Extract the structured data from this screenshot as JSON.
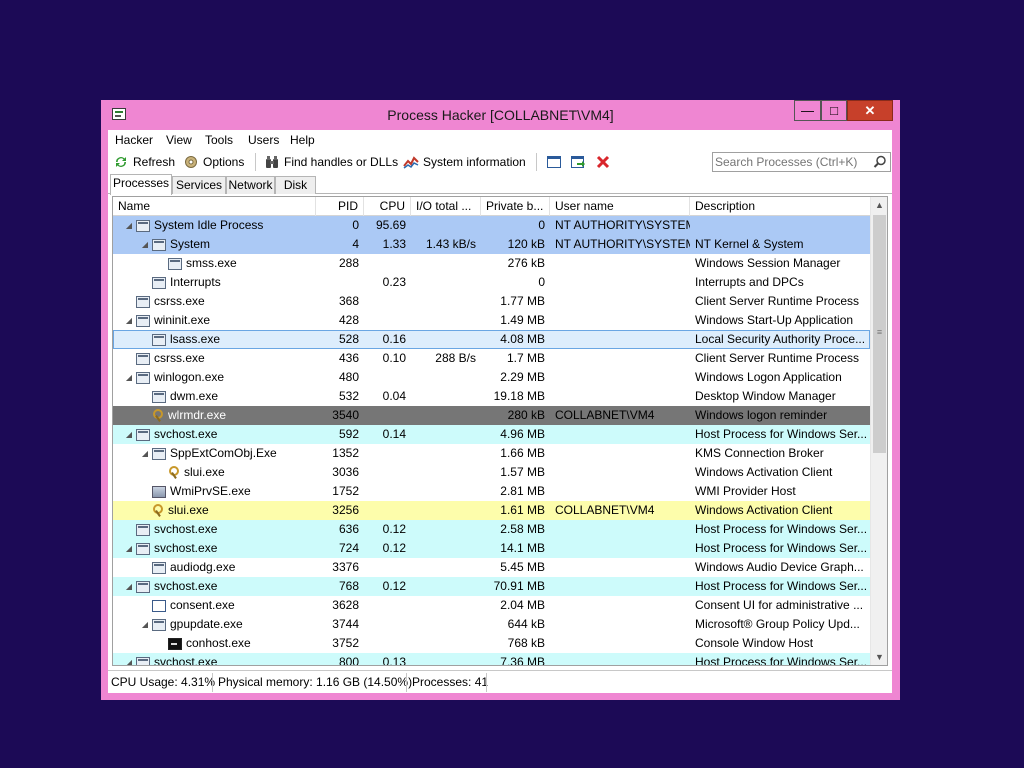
{
  "window": {
    "title": "Process Hacker [COLLABNET\\VM4]",
    "min_label": "—",
    "max_label": "□",
    "close_label": "✕"
  },
  "menu": [
    "Hacker",
    "View",
    "Tools",
    "Users",
    "Help"
  ],
  "toolbar": {
    "refresh": "Refresh",
    "options": "Options",
    "find_handles": "Find handles or DLLs",
    "system_info": "System information",
    "search_placeholder": "Search Processes (Ctrl+K)"
  },
  "tabs": [
    "Processes",
    "Services",
    "Network",
    "Disk"
  ],
  "columns": [
    "Name",
    "PID",
    "CPU",
    "I/O total ...",
    "Private b...",
    "User name",
    "Description"
  ],
  "processes": [
    {
      "name": "System Idle Process",
      "pid": "0",
      "cpu": "95.69",
      "io": "",
      "private": "0",
      "user": "NT AUTHORITY\\SYSTEM",
      "desc": "",
      "icon": "window-icon",
      "expander": "collapse-arrow",
      "style": "system"
    },
    {
      "name": "System",
      "pid": "4",
      "cpu": "1.33",
      "io": "1.43 kB/s",
      "private": "120 kB",
      "user": "NT AUTHORITY\\SYSTEM",
      "desc": "NT Kernel & System",
      "icon": "window-icon",
      "expander": "collapse-arrow",
      "style": "system"
    },
    {
      "name": "smss.exe",
      "pid": "288",
      "cpu": "",
      "io": "",
      "private": "276 kB",
      "user": "",
      "desc": "Windows Session Manager",
      "icon": "window-icon",
      "expander": "",
      "style": ""
    },
    {
      "name": "Interrupts",
      "pid": "",
      "cpu": "0.23",
      "io": "",
      "private": "0",
      "user": "",
      "desc": "Interrupts and DPCs",
      "icon": "window-icon",
      "expander": "",
      "style": ""
    },
    {
      "name": "csrss.exe",
      "pid": "368",
      "cpu": "",
      "io": "",
      "private": "1.77 MB",
      "user": "",
      "desc": "Client Server Runtime Process",
      "icon": "window-icon",
      "expander": "",
      "style": ""
    },
    {
      "name": "wininit.exe",
      "pid": "428",
      "cpu": "",
      "io": "",
      "private": "1.49 MB",
      "user": "",
      "desc": "Windows Start-Up Application",
      "icon": "window-icon",
      "expander": "collapse-arrow",
      "style": ""
    },
    {
      "name": "lsass.exe",
      "pid": "528",
      "cpu": "0.16",
      "io": "",
      "private": "4.08 MB",
      "user": "",
      "desc": "Local Security Authority Proce...",
      "icon": "window-icon",
      "expander": "",
      "style": "selected"
    },
    {
      "name": "csrss.exe",
      "pid": "436",
      "cpu": "0.10",
      "io": "288 B/s",
      "private": "1.7 MB",
      "user": "",
      "desc": "Client Server Runtime Process",
      "icon": "window-icon",
      "expander": "",
      "style": ""
    },
    {
      "name": "winlogon.exe",
      "pid": "480",
      "cpu": "",
      "io": "",
      "private": "2.29 MB",
      "user": "",
      "desc": "Windows Logon Application",
      "icon": "window-icon",
      "expander": "collapse-arrow",
      "style": ""
    },
    {
      "name": "dwm.exe",
      "pid": "532",
      "cpu": "0.04",
      "io": "",
      "private": "19.18 MB",
      "user": "",
      "desc": "Desktop Window Manager",
      "icon": "window-icon",
      "expander": "",
      "style": ""
    },
    {
      "name": "wlrmdr.exe",
      "pid": "3540",
      "cpu": "",
      "io": "",
      "private": "280 kB",
      "user": "COLLABNET\\VM4",
      "desc": "Windows logon reminder",
      "icon": "key-icon",
      "expander": "",
      "style": "dark"
    },
    {
      "name": "svchost.exe",
      "pid": "592",
      "cpu": "0.14",
      "io": "",
      "private": "4.96 MB",
      "user": "",
      "desc": "Host Process for Windows Ser...",
      "icon": "window-icon",
      "expander": "collapse-arrow",
      "style": "service"
    },
    {
      "name": "SppExtComObj.Exe",
      "pid": "1352",
      "cpu": "",
      "io": "",
      "private": "1.66 MB",
      "user": "",
      "desc": "KMS Connection Broker",
      "icon": "window-icon",
      "expander": "collapse-arrow",
      "style": ""
    },
    {
      "name": "slui.exe",
      "pid": "3036",
      "cpu": "",
      "io": "",
      "private": "1.57 MB",
      "user": "",
      "desc": "Windows Activation Client",
      "icon": "key-icon",
      "expander": "",
      "style": ""
    },
    {
      "name": "WmiPrvSE.exe",
      "pid": "1752",
      "cpu": "",
      "io": "",
      "private": "2.81 MB",
      "user": "",
      "desc": "WMI Provider Host",
      "icon": "wmi-icon",
      "expander": "",
      "style": ""
    },
    {
      "name": "slui.exe",
      "pid": "3256",
      "cpu": "",
      "io": "",
      "private": "1.61 MB",
      "user": "COLLABNET\\VM4",
      "desc": "Windows Activation Client",
      "icon": "key-icon",
      "expander": "",
      "style": "yellow"
    },
    {
      "name": "svchost.exe",
      "pid": "636",
      "cpu": "0.12",
      "io": "",
      "private": "2.58 MB",
      "user": "",
      "desc": "Host Process for Windows Ser...",
      "icon": "window-icon",
      "expander": "",
      "style": "service"
    },
    {
      "name": "svchost.exe",
      "pid": "724",
      "cpu": "0.12",
      "io": "",
      "private": "14.1 MB",
      "user": "",
      "desc": "Host Process for Windows Ser...",
      "icon": "window-icon",
      "expander": "collapse-arrow",
      "style": "service"
    },
    {
      "name": "audiodg.exe",
      "pid": "3376",
      "cpu": "",
      "io": "",
      "private": "5.45 MB",
      "user": "",
      "desc": "Windows Audio Device Graph...",
      "icon": "window-icon",
      "expander": "",
      "style": ""
    },
    {
      "name": "svchost.exe",
      "pid": "768",
      "cpu": "0.12",
      "io": "",
      "private": "70.91 MB",
      "user": "",
      "desc": "Host Process for Windows Ser...",
      "icon": "window-icon",
      "expander": "collapse-arrow",
      "style": "service"
    },
    {
      "name": "consent.exe",
      "pid": "3628",
      "cpu": "",
      "io": "",
      "private": "2.04 MB",
      "user": "",
      "desc": "Consent UI for administrative ...",
      "icon": "box-icon",
      "expander": "",
      "style": ""
    },
    {
      "name": "gpupdate.exe",
      "pid": "3744",
      "cpu": "",
      "io": "",
      "private": "644 kB",
      "user": "",
      "desc": "Microsoft® Group Policy Upd...",
      "icon": "window-icon",
      "expander": "collapse-arrow",
      "style": ""
    },
    {
      "name": "conhost.exe",
      "pid": "3752",
      "cpu": "",
      "io": "",
      "private": "768 kB",
      "user": "",
      "desc": "Console Window Host",
      "icon": "console-icon",
      "expander": "",
      "style": ""
    },
    {
      "name": "svchost.exe",
      "pid": "800",
      "cpu": "0.13",
      "io": "",
      "private": "7.36 MB",
      "user": "",
      "desc": "Host Process for Windows Ser...",
      "icon": "window-icon",
      "expander": "collapse-arrow",
      "style": "service"
    }
  ],
  "status": {
    "cpu": "CPU Usage: 4.31%",
    "memory": "Physical memory: 1.16 GB (14.50%)",
    "processes": "Processes: 41"
  },
  "colors": {
    "desktop": "#1c0a56",
    "window_frame": "#ef86d2",
    "system_row": "#abc9f5",
    "service_row": "#cdfbfb",
    "selected_row": "#ddedfc",
    "elevated_row": "#767676",
    "own_process_row": "#fdfdab",
    "close_button": "#c7402a"
  }
}
